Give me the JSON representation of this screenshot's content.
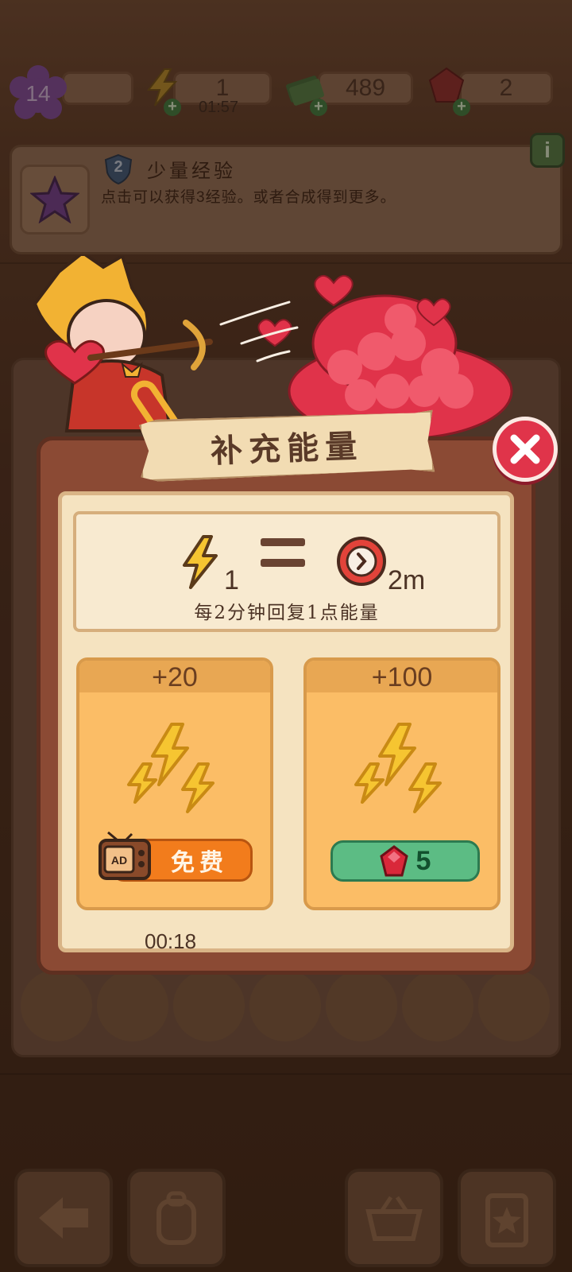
{
  "hud": {
    "level": "14",
    "energy_value": "1",
    "energy_timer": "01:57",
    "cash_value": "489",
    "gems_value": "2"
  },
  "quest": {
    "badge_number": "2",
    "title": "少量经验",
    "description": "点击可以获得3经验。或者合成得到更多。",
    "info_icon": "i"
  },
  "dialog": {
    "title": "补充能量",
    "rate": {
      "energy_amount": "1",
      "time_amount": "2m",
      "description": "每2分钟回复1点能量"
    },
    "packs": [
      {
        "amount": "+20",
        "button_label": "免费",
        "button_icon": "ad-tv-icon",
        "cooldown": "00:18"
      },
      {
        "amount": "+100",
        "button_label": "5",
        "button_icon": "ruby-gem-icon"
      }
    ],
    "close_icon": "close-icon"
  },
  "colors": {
    "dialog_frame": "#8b4a34",
    "panel_cream": "#f5e3c0",
    "pack_orange": "#fbbd66",
    "free_button": "#f27c1c",
    "gem_button": "#5cbc84",
    "close_red": "#e0344a",
    "energy_yellow": "#f6c531"
  }
}
